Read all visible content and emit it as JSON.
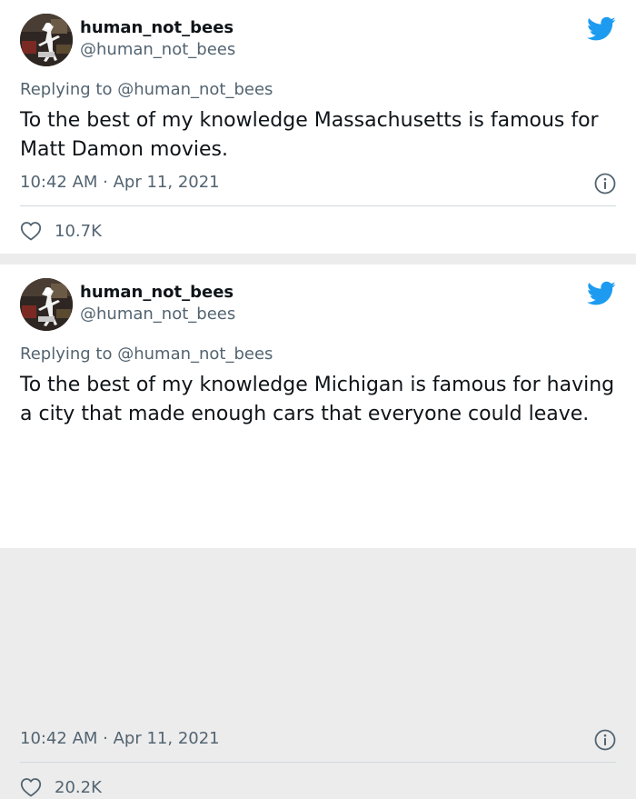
{
  "colors": {
    "twitter_blue": "#1d9bf0",
    "text_primary": "#0f1419",
    "text_secondary": "#536471",
    "divider": "#cfd9de",
    "background": "#ececec"
  },
  "tweets": [
    {
      "display_name": "human_not_bees",
      "handle": "@human_not_bees",
      "replying_label": "Replying to",
      "replying_to": "@human_not_bees",
      "text": "To the best of my knowledge Massachusetts is famous for Matt Damon movies.",
      "timestamp": "10:42 AM · Apr 11, 2021",
      "likes": "10.7K",
      "icons": [
        "avatar",
        "twitter-bird-icon",
        "info-icon",
        "heart-icon"
      ]
    },
    {
      "display_name": "human_not_bees",
      "handle": "@human_not_bees",
      "replying_label": "Replying to",
      "replying_to": "@human_not_bees",
      "text": "To the best of my knowledge Michigan is famous for having a city that made enough cars that everyone could leave.",
      "timestamp": "10:42 AM · Apr 11, 2021",
      "likes": "20.2K",
      "icons": [
        "avatar",
        "twitter-bird-icon",
        "info-icon",
        "heart-icon"
      ]
    }
  ]
}
